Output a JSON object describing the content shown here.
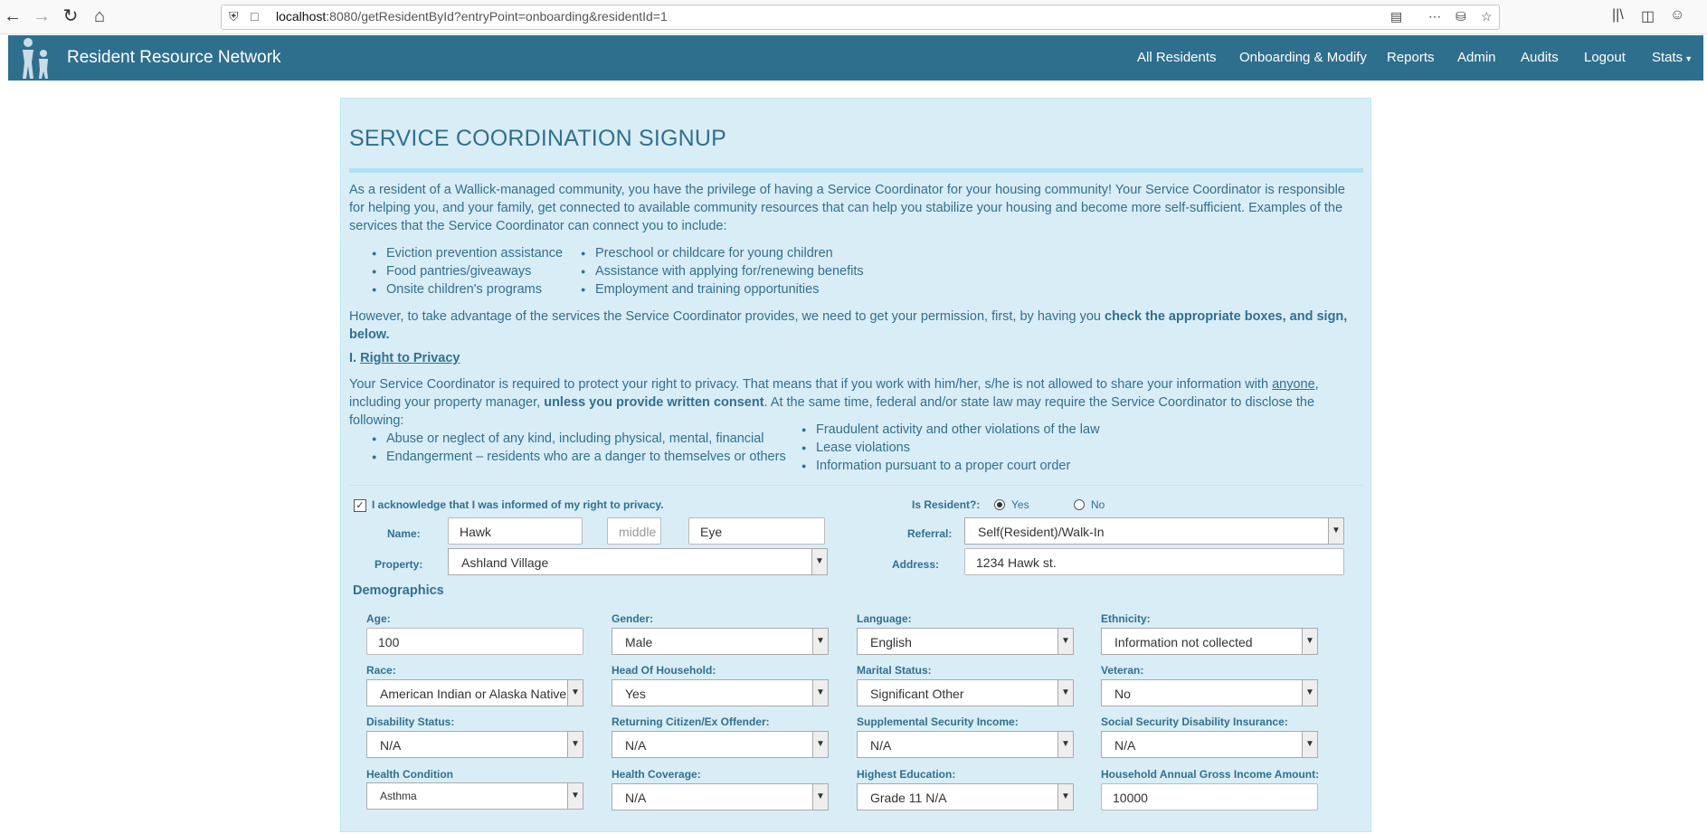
{
  "browser": {
    "url_host": "localhost",
    "url_rest": ":8080/getResidentById?entryPoint=onboarding&residentId=1"
  },
  "navbar": {
    "brand": "Resident Resource Network",
    "items": [
      "All Residents",
      "Onboarding & Modify",
      "Reports",
      "Admin",
      "Audits",
      "Logout",
      "Stats"
    ]
  },
  "page": {
    "title": "SERVICE COORDINATION SIGNUP",
    "intro": "As a resident of a Wallick-managed community, you have the privilege of having a Service Coordinator for your housing community! Your Service Coordinator is responsible for helping you, and your family, get connected to available community resources that can help you stabilize your housing and become more self-sufficient. Examples of the services that the Service Coordinator can connect you to include:",
    "services_left": [
      "Eviction prevention assistance",
      "Food pantries/giveaways",
      "Onsite children's programs"
    ],
    "services_right": [
      "Preschool or childcare for young children",
      "Assistance with applying for/renewing benefits",
      "Employment and training opportunities"
    ],
    "permission_text": "However, to take advantage of the services the Service Coordinator provides, we need to get your permission, first, by having you ",
    "permission_bold": "check the appropriate boxes, and sign, below.",
    "privacy_prefix": "I. ",
    "privacy_title": "Right to Privacy",
    "privacy_p1": "Your Service Coordinator is required to protect your right to privacy. That means that if you work with him/her, s/he is not allowed to share your information with ",
    "privacy_anyone": "anyone",
    "privacy_p2": ", including your property manager, ",
    "privacy_bold": "unless you provide written consent",
    "privacy_p3": ". At the same time, federal and/or state law may require the Service Coordinator to disclose the following:",
    "disclose_left": [
      "Abuse or neglect of any kind, including physical, mental, financial",
      "Endangerment – residents who are a danger to themselves or others"
    ],
    "disclose_right": [
      "Fraudulent activity and other violations of the law",
      "Lease violations",
      "Information pursuant to a proper court order"
    ]
  },
  "form": {
    "ack_label": "I acknowledge that I was informed of my right to privacy.",
    "ack_checked": true,
    "is_resident_label": "Is Resident?:",
    "yes_label": "Yes",
    "no_label": "No",
    "name_label": "Name:",
    "first_name": "Hawk",
    "middle_placeholder": "middle",
    "last_name": "Eye",
    "property_label": "Property:",
    "property_value": "Ashland Village",
    "referral_label": "Referral:",
    "referral_value": "Self(Resident)/Walk-In",
    "address_label": "Address:",
    "address_value": "1234 Hawk st.",
    "demographics_title": "Demographics",
    "fields": [
      {
        "label": "Age:",
        "value": "100",
        "type": "input"
      },
      {
        "label": "Gender:",
        "value": "Male",
        "type": "select"
      },
      {
        "label": "Language:",
        "value": "English",
        "type": "select"
      },
      {
        "label": "Ethnicity:",
        "value": "Information not collected",
        "type": "select"
      },
      {
        "label": "Race:",
        "value": "American Indian or Alaska Native",
        "type": "select"
      },
      {
        "label": "Head Of Household:",
        "value": "Yes",
        "type": "select"
      },
      {
        "label": "Marital Status:",
        "value": "Significant Other",
        "type": "select"
      },
      {
        "label": "Veteran:",
        "value": "No",
        "type": "select"
      },
      {
        "label": "Disability Status:",
        "value": "N/A",
        "type": "select"
      },
      {
        "label": "Returning Citizen/Ex Offender:",
        "value": "N/A",
        "type": "select"
      },
      {
        "label": "Supplemental Security Income:",
        "value": "N/A",
        "type": "select"
      },
      {
        "label": "Social Security Disability Insurance:",
        "value": "N/A",
        "type": "select"
      },
      {
        "label": "Health Condition",
        "value": "Asthma",
        "type": "select"
      },
      {
        "label": "Health Coverage:",
        "value": "N/A",
        "type": "select"
      },
      {
        "label": "Highest Education:",
        "value": "Grade 11 N/A",
        "type": "select"
      },
      {
        "label": "Household Annual Gross Income Amount:",
        "value": "10000",
        "type": "input"
      }
    ]
  }
}
